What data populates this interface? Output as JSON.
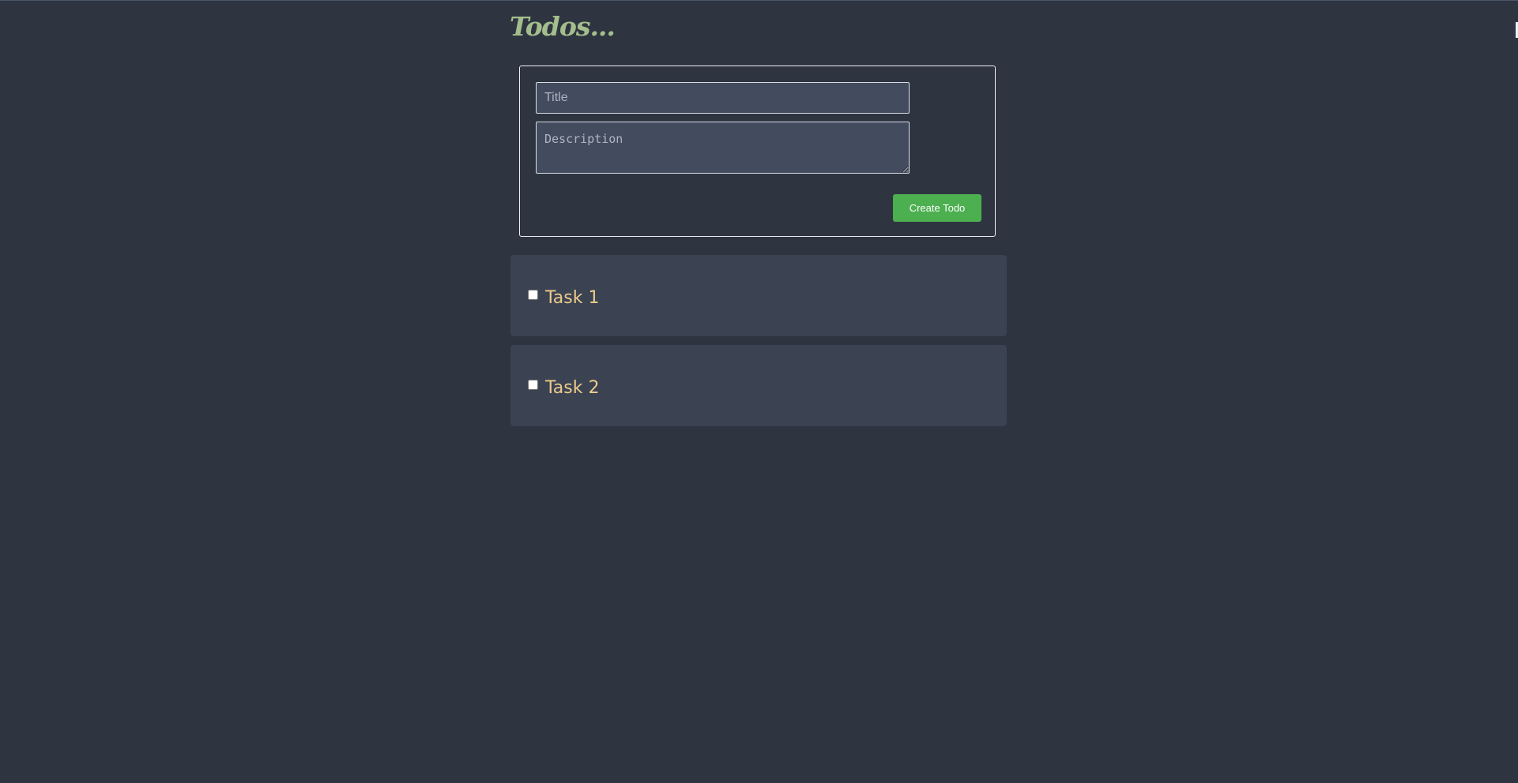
{
  "header": {
    "title": "Todos..."
  },
  "form": {
    "title_placeholder": "Title",
    "title_value": "",
    "description_placeholder": "Description",
    "description_value": "",
    "create_label": "Create Todo"
  },
  "tasks": [
    {
      "title": "Task 1",
      "checked": false
    },
    {
      "title": "Task 2",
      "checked": false
    }
  ],
  "colors": {
    "background": "#2e3440",
    "title_green": "#a3be8c",
    "task_title": "#ebcb8b",
    "button_green": "#4caf50",
    "card": "#3b4252",
    "input": "#434c5e"
  }
}
